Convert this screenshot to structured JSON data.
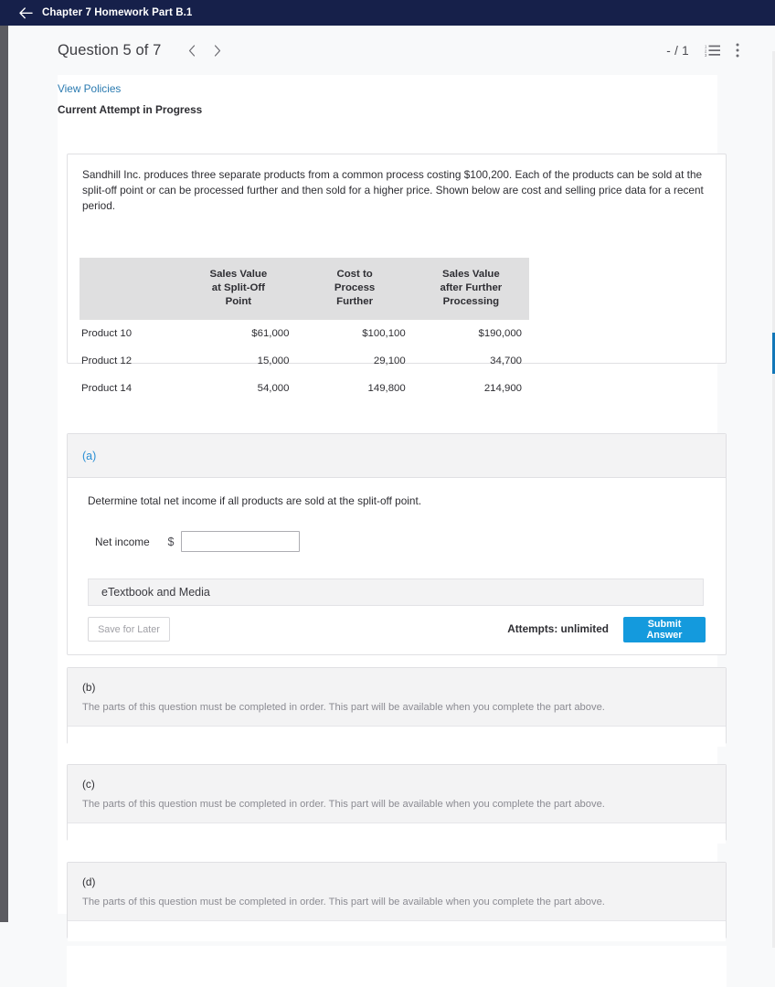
{
  "topbar": {
    "back_icon": "back-arrow-icon",
    "title": "Chapter 7 Homework Part B.1"
  },
  "question_header": {
    "title": "Question 5 of 7",
    "prev_icon": "chevron-left-icon",
    "next_icon": "chevron-right-icon",
    "score": "- / 1",
    "list_icon": "numbered-list-icon",
    "menu_icon": "kebab-menu-icon"
  },
  "links": {
    "view_policies": "View Policies"
  },
  "status": {
    "attempt": "Current Attempt in Progress"
  },
  "problem": {
    "text": "Sandhill Inc. produces three separate products from a common process costing $100,200. Each of the products can be sold at the split-off point or can be processed further and then sold for a higher price. Shown below are cost and selling price data for a recent period.",
    "table": {
      "headers": [
        "",
        "Sales Value at Split-Off Point",
        "Cost to Process Further",
        "Sales Value after Further Processing"
      ],
      "headers_lines": [
        [
          ""
        ],
        [
          "Sales Value",
          "at Split-Off",
          "Point"
        ],
        [
          "Cost to",
          "Process",
          "Further"
        ],
        [
          "Sales Value",
          "after Further",
          "Processing"
        ]
      ],
      "rows": [
        {
          "label": "Product 10",
          "split_off": "$61,000",
          "process_further": "$100,100",
          "after_processing": "$190,000"
        },
        {
          "label": "Product 12",
          "split_off": "15,000",
          "process_further": "29,100",
          "after_processing": "34,700"
        },
        {
          "label": "Product 14",
          "split_off": "54,000",
          "process_further": "149,800",
          "after_processing": "214,900"
        }
      ]
    }
  },
  "part_a": {
    "letter": "(a)",
    "prompt": "Determine total net income if all products are sold at the split-off point.",
    "answer_label": "Net income",
    "currency_symbol": "$",
    "answer_value": "",
    "answer_placeholder": "",
    "etextbook_label": "eTextbook and Media",
    "save_label": "Save for Later",
    "attempts_label": "Attempts: unlimited",
    "submit_label": "Submit Answer"
  },
  "locked_parts": [
    {
      "letter": "(b)",
      "message": "The parts of this question must be completed in order. This part will be available when you complete the part above."
    },
    {
      "letter": "(c)",
      "message": "The parts of this question must be completed in order. This part will be available when you complete the part above."
    },
    {
      "letter": "(d)",
      "message": "The parts of this question must be completed in order. This part will be available when you complete the part above."
    }
  ],
  "colors": {
    "topbar_bg": "#16204a",
    "accent_blue": "#149add",
    "link_blue": "#2a7ab0",
    "scrollbar_thumb": "#1277b8",
    "table_header_bg": "#dfdfe0"
  }
}
